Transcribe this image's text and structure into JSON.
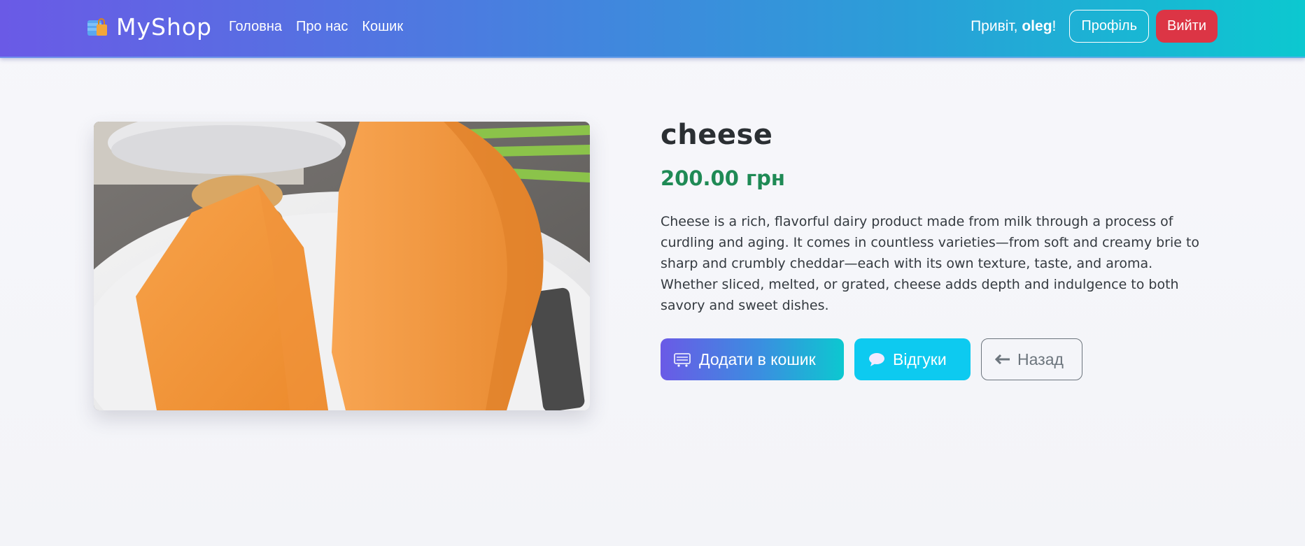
{
  "navbar": {
    "brand": "MyShop",
    "brand_icon": "shopping-bag-icon",
    "links": [
      "Головна",
      "Про нас",
      "Кошик"
    ],
    "greeting_prefix": "Привіт, ",
    "username": "oleg",
    "greeting_suffix": "!",
    "profile_label": "Профіль",
    "logout_label": "Вийти"
  },
  "product": {
    "image": "cheese-photo",
    "title": "cheese",
    "price": "200.00 грн",
    "description": "Cheese is a rich, flavorful dairy product made from milk through a process of curdling and aging. It comes in countless varieties—from soft and creamy brie to sharp and crumbly cheddar—each with its own texture, taste, and aroma. Whether sliced, melted, or grated, cheese adds depth and indulgence to both savory and sweet dishes."
  },
  "actions": {
    "add_to_cart": "Додати в кошик",
    "add_to_cart_icon": "cart-icon",
    "reviews": "Відгуки",
    "reviews_icon": "speech-bubble-icon",
    "back": "Назад",
    "back_icon": "arrow-left-icon"
  },
  "colors": {
    "nav_start": "#6a5ae6",
    "nav_end": "#0cc8d0",
    "logout": "#dc3545",
    "price": "#1f8a55",
    "reviews": "#0dcaf0"
  }
}
